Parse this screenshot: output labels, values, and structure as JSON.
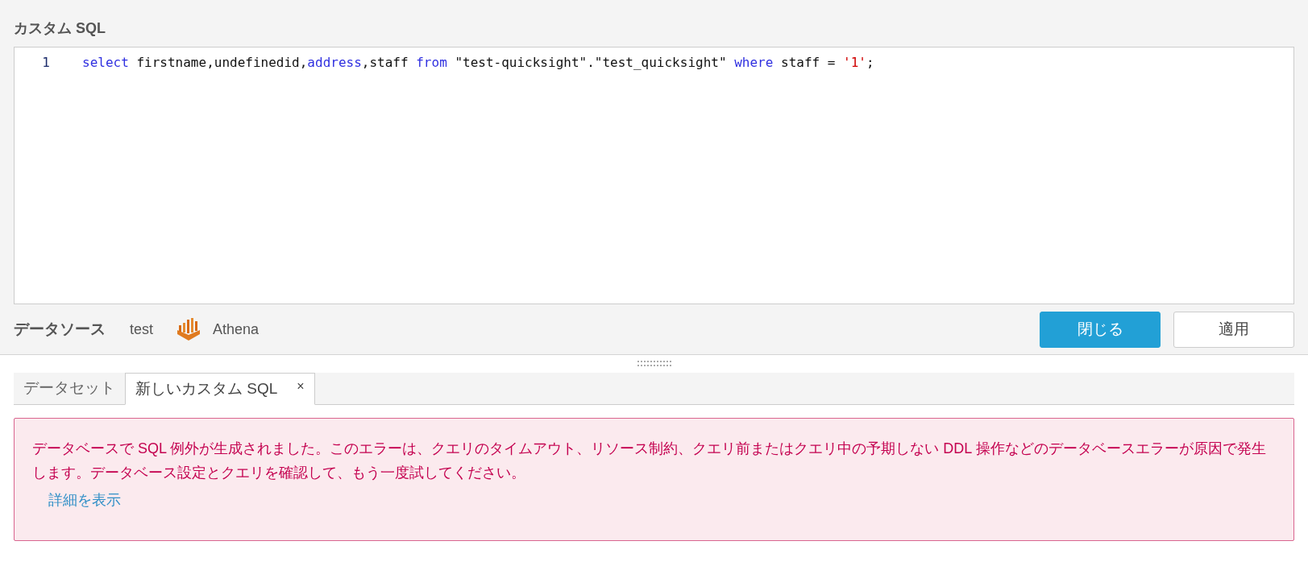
{
  "title": "カスタム SQL",
  "editor": {
    "lines": [
      {
        "number": "1",
        "tokens": [
          {
            "text": "select",
            "kind": "keyword"
          },
          {
            "text": " firstname,undefinedid,",
            "kind": "plain"
          },
          {
            "text": "address",
            "kind": "keyword"
          },
          {
            "text": ",staff ",
            "kind": "plain"
          },
          {
            "text": "from",
            "kind": "keyword"
          },
          {
            "text": " \"test-quicksight\".\"test_quicksight\" ",
            "kind": "plain"
          },
          {
            "text": "where",
            "kind": "keyword"
          },
          {
            "text": " staff = ",
            "kind": "plain"
          },
          {
            "text": "'1'",
            "kind": "string"
          },
          {
            "text": ";",
            "kind": "plain"
          }
        ]
      }
    ]
  },
  "data_source": {
    "label": "データソース",
    "name": "test",
    "engine": "Athena"
  },
  "buttons": [
    {
      "label": "閉じる",
      "kind": "primary"
    },
    {
      "label": "適用",
      "kind": "secondary"
    }
  ],
  "tabs": [
    {
      "label": "データセット",
      "selected": false
    },
    {
      "label": "新しいカスタム SQL",
      "selected": true,
      "close": "×"
    }
  ],
  "error": {
    "message": "データベースで SQL 例外が生成されました。このエラーは、クエリのタイムアウト、リソース制約、クエリ前またはクエリ中の予期しない DDL 操作などのデータベースエラーが原因で発生します。データベース設定とクエリを確認して、もう一度試してください。",
    "link": "詳細を表示"
  }
}
